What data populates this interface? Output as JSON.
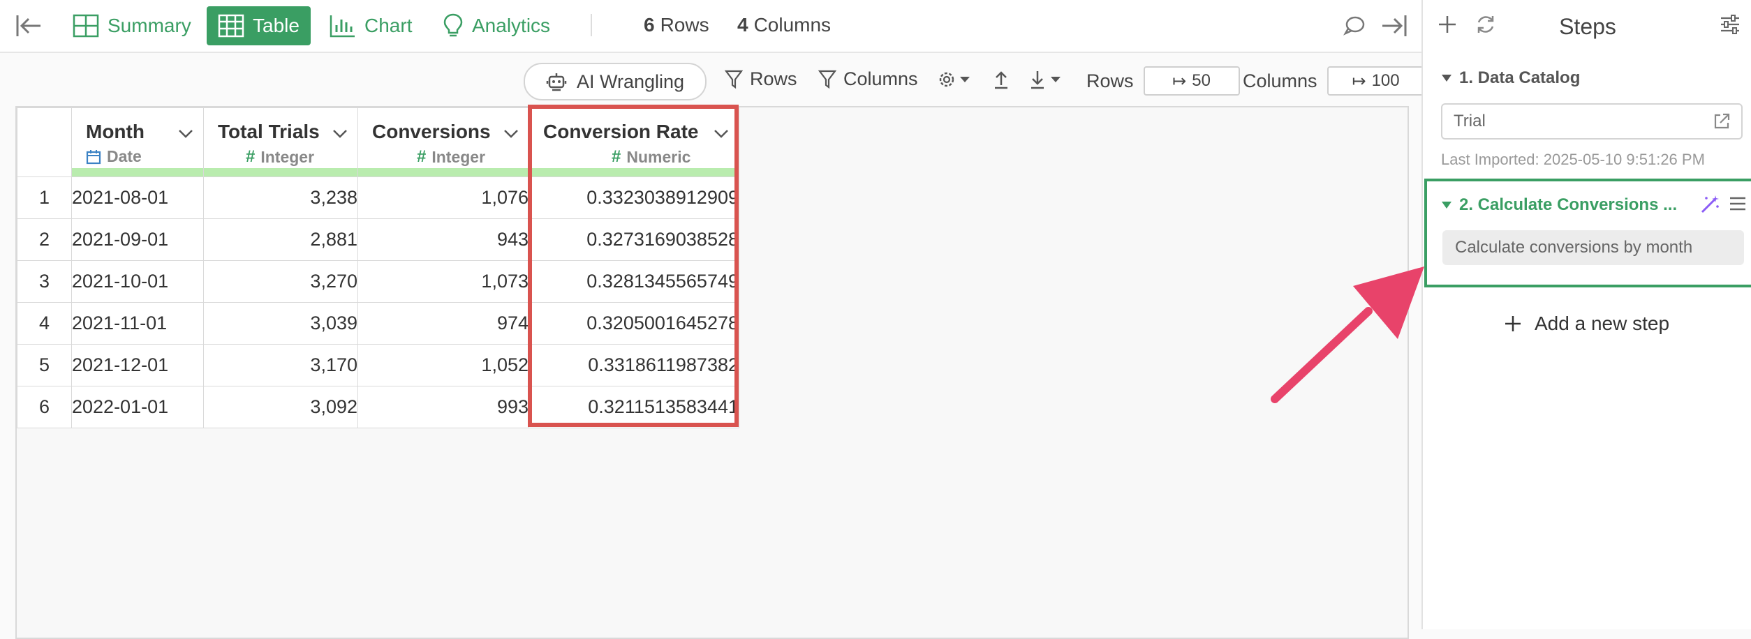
{
  "topbar": {
    "tabs": [
      {
        "label": "Summary",
        "icon": "summary-grid-icon",
        "active": false
      },
      {
        "label": "Table",
        "icon": "table-icon",
        "active": true
      },
      {
        "label": "Chart",
        "icon": "bar-chart-icon",
        "active": false
      },
      {
        "label": "Analytics",
        "icon": "lightbulb-icon",
        "active": false
      }
    ],
    "rows_count": "6",
    "rows_label": "Rows",
    "cols_count": "4",
    "cols_label": "Columns"
  },
  "toolbar": {
    "ai_wrangling": "AI Wrangling",
    "rows_filter": "Rows",
    "columns_filter": "Columns",
    "rows_limit_label": "Rows",
    "rows_limit_value": "50",
    "columns_limit_label": "Columns",
    "columns_limit_value": "100"
  },
  "table": {
    "columns": [
      {
        "name": "Month",
        "type": "Date"
      },
      {
        "name": "Total Trials",
        "type": "Integer"
      },
      {
        "name": "Conversions",
        "type": "Integer"
      },
      {
        "name": "Conversion Rate",
        "type": "Numeric"
      }
    ],
    "rows": [
      {
        "n": "1",
        "month": "2021-08-01",
        "trials": "3,238",
        "conv": "1,076",
        "rate": "0.3323038912909"
      },
      {
        "n": "2",
        "month": "2021-09-01",
        "trials": "2,881",
        "conv": "943",
        "rate": "0.3273169038528"
      },
      {
        "n": "3",
        "month": "2021-10-01",
        "trials": "3,270",
        "conv": "1,073",
        "rate": "0.3281345565749"
      },
      {
        "n": "4",
        "month": "2021-11-01",
        "trials": "3,039",
        "conv": "974",
        "rate": "0.3205001645278"
      },
      {
        "n": "5",
        "month": "2021-12-01",
        "trials": "3,170",
        "conv": "1,052",
        "rate": "0.3318611987382"
      },
      {
        "n": "6",
        "month": "2022-01-01",
        "trials": "3,092",
        "conv": "993",
        "rate": "0.3211513583441"
      }
    ]
  },
  "steps": {
    "title": "Steps",
    "step1": {
      "title": "1. Data Catalog",
      "source": "Trial",
      "last_imported": "Last Imported: 2025-05-10 9:51:26 PM"
    },
    "step2": {
      "title": "2. Calculate Conversions ...",
      "description": "Calculate conversions by month"
    },
    "add_step": "Add a new step"
  },
  "colors": {
    "accent": "#3a9e63",
    "highlight": "#d9534f",
    "arrow": "#e8436a",
    "type_bar": "#b9ecae"
  }
}
